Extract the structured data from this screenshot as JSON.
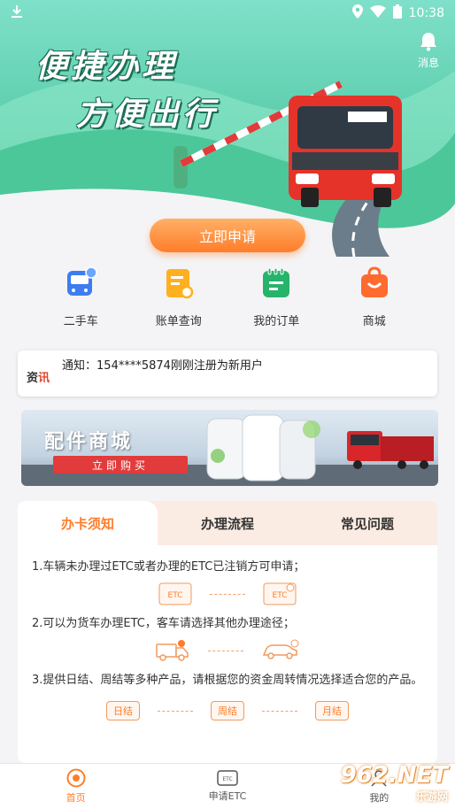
{
  "status_bar": {
    "time": "10:38"
  },
  "hero": {
    "line1": "便捷办理",
    "line2": "方便出行",
    "messages_label": "消息",
    "apply_label": "立即申请"
  },
  "quick_menu": [
    {
      "label": "二手车",
      "icon": "bus-icon",
      "color": "#3d7df0"
    },
    {
      "label": "账单查询",
      "icon": "bill-search-icon",
      "color": "#ffb020"
    },
    {
      "label": "我的订单",
      "icon": "order-icon",
      "color": "#26b36a"
    },
    {
      "label": "商城",
      "icon": "shopping-bag-icon",
      "color": "#ff6a2e"
    }
  ],
  "notice": {
    "tag_a": "资",
    "tag_b": "讯",
    "text": "通知：154****5874刚刚注册为新用户"
  },
  "banner": {
    "title": "配件商城",
    "button": "立即购买"
  },
  "info_card": {
    "tabs": [
      "办卡须知",
      "办理流程",
      "常见问题"
    ],
    "active_tab": 0,
    "rules": [
      "1.车辆未办理过ETC或者办理的ETC已注销方可申请；",
      "2.可以为货车办理ETC，客车请选择其他办理途径；",
      "3.提供日结、周结等多种产品，请根据您的资金周转情况选择适合您的产品。"
    ],
    "etc_label": "ETC",
    "pills": [
      "日结",
      "周结",
      "月结"
    ]
  },
  "bottom_nav": [
    {
      "label": "首页",
      "icon": "home-icon",
      "active": true
    },
    {
      "label": "申请ETC",
      "icon": "etc-card-icon",
      "active": false
    },
    {
      "label": "我的",
      "icon": "profile-icon",
      "active": false
    }
  ],
  "watermark": {
    "brand": "962.NET",
    "sub": "乐游网"
  },
  "colors": {
    "accent": "#ff7d2a",
    "hero_green": "#5fcfae"
  }
}
